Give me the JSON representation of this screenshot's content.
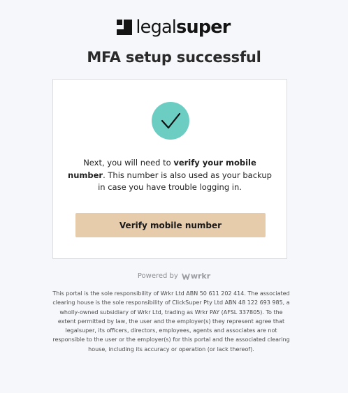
{
  "brand": {
    "logo_light": "legal",
    "logo_bold": "super",
    "logo_icon": "legalsuper-mark-icon"
  },
  "page": {
    "title": "MFA setup successful"
  },
  "card": {
    "status_icon": "checkmark-circle-icon",
    "accent_color": "#6ccdc3",
    "message_prefix": "Next, you will need to ",
    "message_bold": "verify your mobile number",
    "message_suffix": ". This number is also used as your backup in case you have trouble logging in.",
    "button_label": "Verify mobile number",
    "button_color": "#e7ccac"
  },
  "footer": {
    "powered_by": "Powered by",
    "powered_brand": "wrkr",
    "powered_icon": "wrkr-logo-icon",
    "disclaimer": "This portal is the sole responsibility of Wrkr Ltd ABN 50 611 202 414. The associated clearing house is the sole responsibility of ClickSuper Pty Ltd ABN 48 122 693 985, a wholly-owned subsidiary of Wrkr Ltd, trading as Wrkr PAY (AFSL 337805). To the extent permitted by law, the user and the employer(s) they represent agree that legalsuper, its officers, directors, employees, agents and associates are not responsible to the user or the employer(s) for this portal and the associated clearing house, including its accuracy or operation (or lack thereof)."
  }
}
